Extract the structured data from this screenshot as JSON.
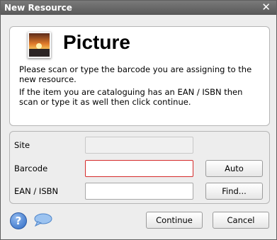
{
  "window": {
    "title": "New Resource",
    "close_glyph": "✕"
  },
  "info": {
    "heading": "Picture",
    "icon": "picture-thumbnail-icon",
    "line1": "Please scan or type the barcode you are assigning to the new resource.",
    "line2": "If the item you are cataloguing has an EAN / ISBN then scan or type it as well then click continue."
  },
  "form": {
    "site_label": "Site",
    "site_value": "",
    "barcode_label": "Barcode",
    "barcode_value": "",
    "ean_label": "EAN / ISBN",
    "ean_value": "",
    "auto_button": "Auto",
    "find_button": "Find..."
  },
  "footer": {
    "help_icon": "help-icon",
    "help_glyph": "?",
    "chat_icon": "chat-bubble-icon",
    "continue_button": "Continue",
    "cancel_button": "Cancel"
  },
  "colors": {
    "titlebar": "#656565",
    "error_border": "#d52c2c",
    "help_blue": "#2f6bc4"
  }
}
